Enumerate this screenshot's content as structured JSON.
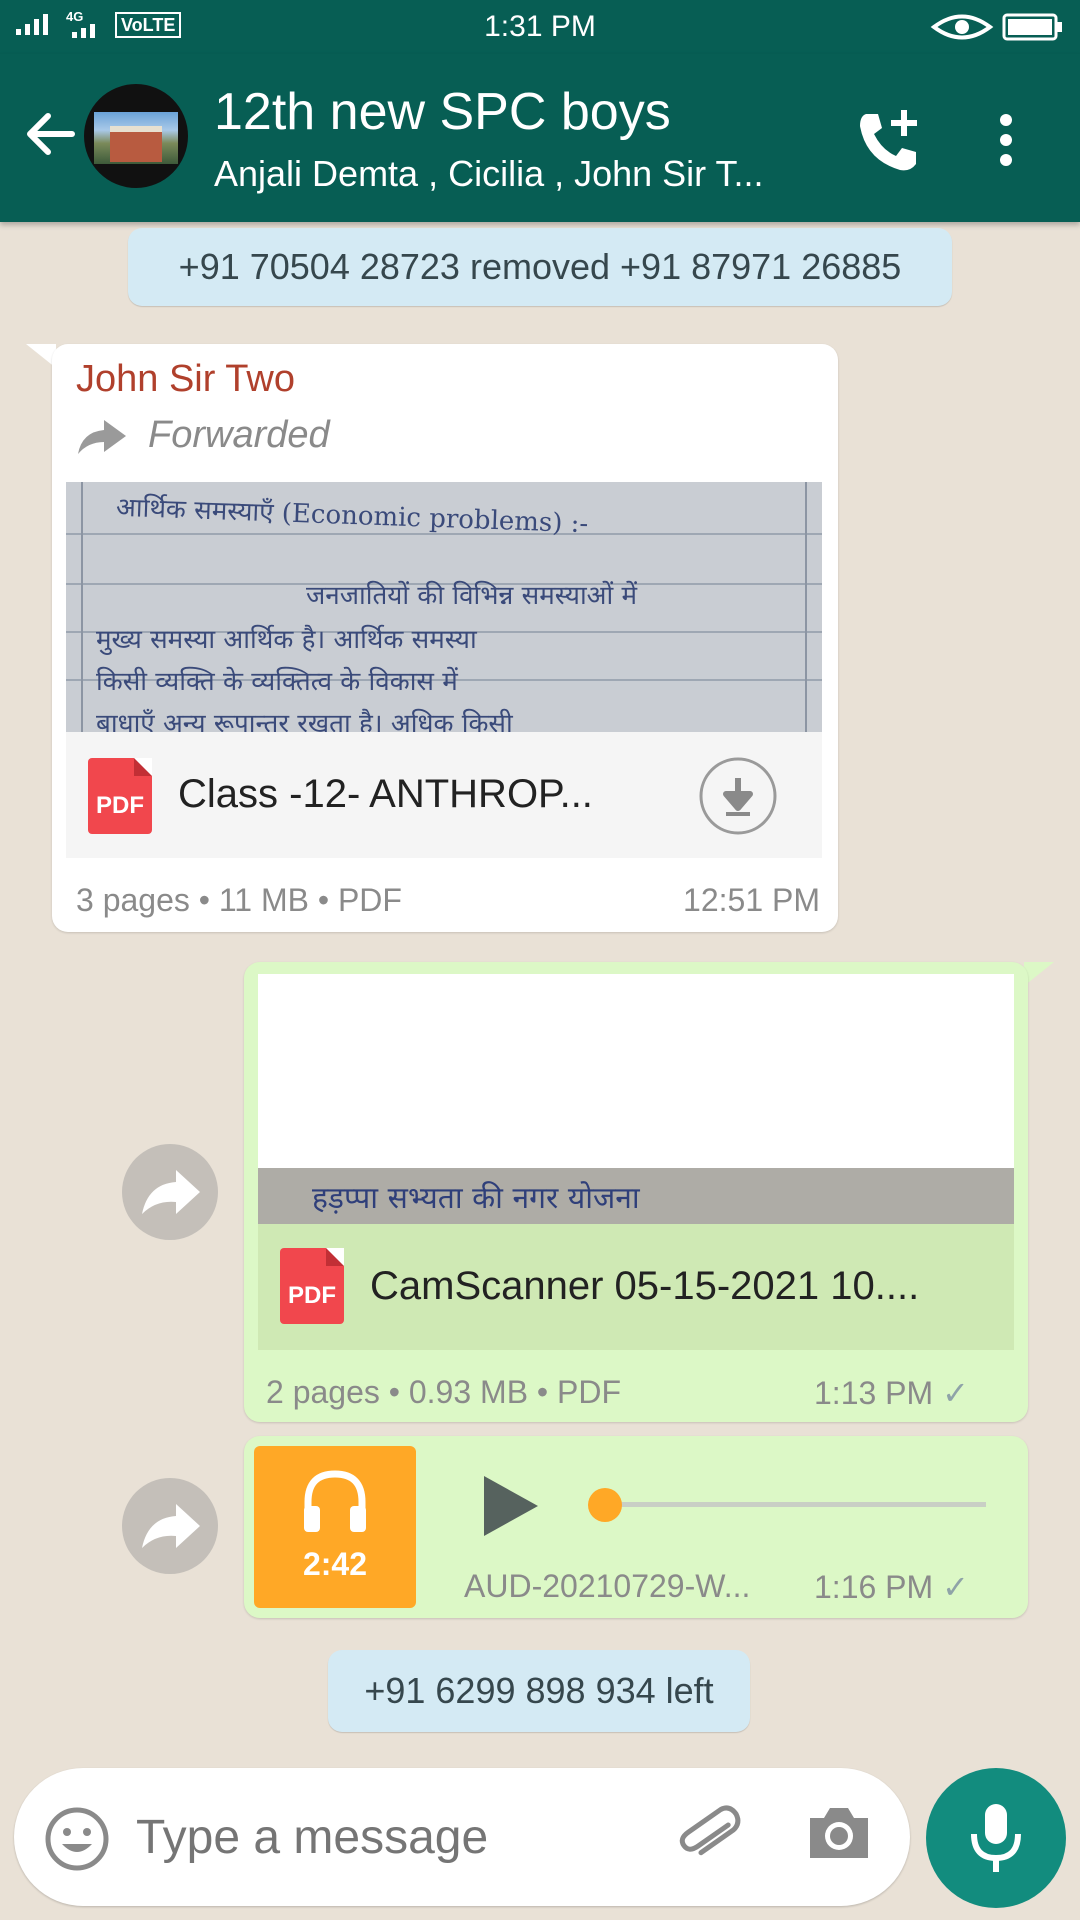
{
  "status_bar": {
    "time": "1:31 PM",
    "network": "4G",
    "volte": "VoLTE"
  },
  "header": {
    "title": "12th new SPC boys",
    "subtitle": "Anjali Demta , Cicilia , John Sir T...",
    "icons": [
      "back-arrow-icon",
      "group-avatar",
      "add-call-icon",
      "more-vert-icon"
    ]
  },
  "messages": {
    "sys_removed": "+91 70504 28723 removed +91 87971 26885",
    "msg1": {
      "sender": "John Sir Two",
      "forwarded": "Forwarded",
      "file_icon": "PDF",
      "file_name": "Class -12- ANTHROP...",
      "pages": "3 pages",
      "size": "11 MB",
      "type": "PDF",
      "time": "12:51 PM",
      "handwriting": [
        "आर्थिक समस्याएँ (Economic problems) :-",
        "जनजातियों की विभिन्न समस्याओं में",
        "मुख्य समस्या आर्थिक है। आर्थिक समस्या",
        "किसी व्यक्ति के व्यक्तित्व के विकास में",
        "बाधाएँ अन्य रूपान्तर रखता है। अधिक किसी"
      ]
    },
    "msg2": {
      "file_icon": "PDF",
      "file_name": "CamScanner 05-15-2021 10....",
      "pages": "2 pages",
      "size": "0.93 MB",
      "type": "PDF",
      "time": "1:13 PM",
      "preview_text": "हड़प्पा सभ्यता की नगर योजना"
    },
    "msg3": {
      "duration": "2:42",
      "file_name": "AUD-20210729-W...",
      "time": "1:16 PM",
      "progress": 0
    },
    "sys_left": "+91 6299 898 934 left"
  },
  "input": {
    "placeholder": "Type a message"
  },
  "colors": {
    "header": "#075e54",
    "outgoing": "#dcf8c6",
    "sender": "#b0402c",
    "audio": "#ffa826",
    "mic": "#128c7e"
  }
}
